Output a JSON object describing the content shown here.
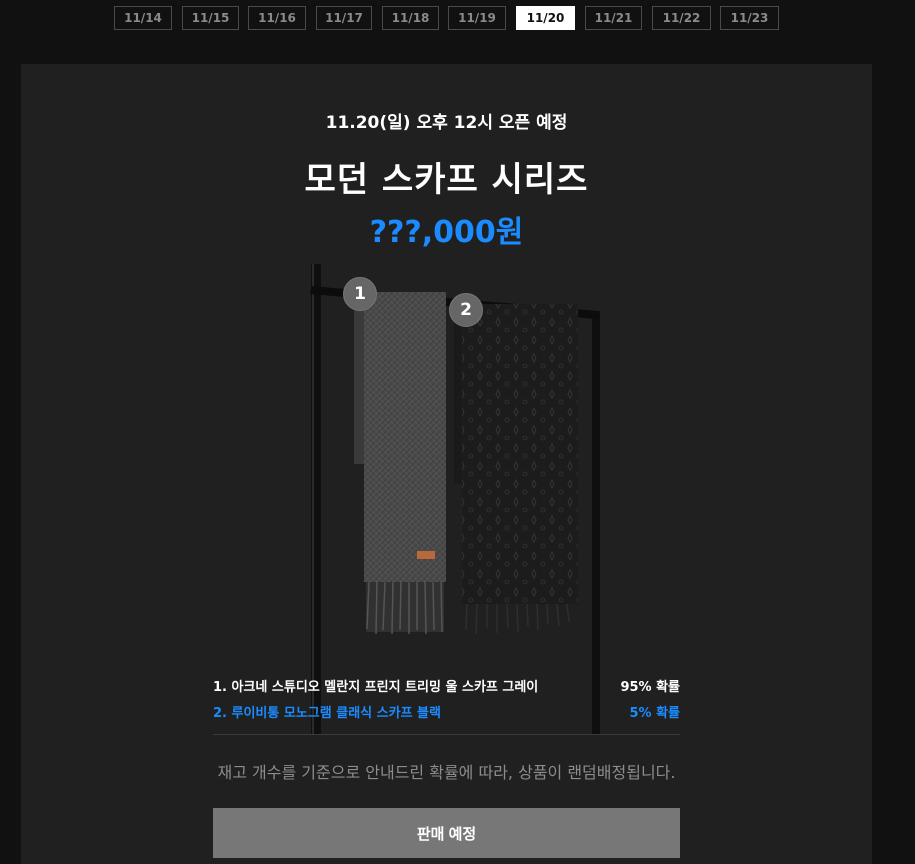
{
  "date_tabs": [
    {
      "label": "11/14",
      "active": false
    },
    {
      "label": "11/15",
      "active": false
    },
    {
      "label": "11/16",
      "active": false
    },
    {
      "label": "11/17",
      "active": false
    },
    {
      "label": "11/18",
      "active": false
    },
    {
      "label": "11/19",
      "active": false
    },
    {
      "label": "11/20",
      "active": true
    },
    {
      "label": "11/21",
      "active": false
    },
    {
      "label": "11/22",
      "active": false
    },
    {
      "label": "11/23",
      "active": false
    }
  ],
  "drop": {
    "open_date": "11.20(일) 오후 12시 오픈 예정",
    "title": "모던 스카프 시리즈",
    "price": "???,000원",
    "price_color": "#1a8cff",
    "image_badges": [
      "1",
      "2"
    ],
    "items": [
      {
        "name": "1. 아크네 스튜디오 멜란지 프린지 트리밍 울 스카프 그레이",
        "probability": "95% 확률",
        "color": "#ffffff"
      },
      {
        "name": "2. 루이비통 모노그램 클래식 스카프 블랙",
        "probability": "5% 확률",
        "color": "#1a8cff"
      }
    ],
    "notice": "재고 개수를 기준으로 안내드린 확률에 따라, 상품이 랜덤배정됩니다.",
    "button_label": "판매 예정"
  }
}
